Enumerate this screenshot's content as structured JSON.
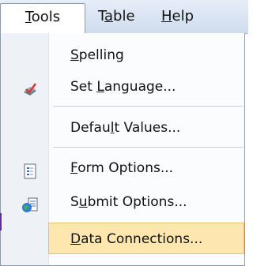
{
  "menubar": {
    "tools": {
      "pre": "",
      "ul": "T",
      "post": "ools"
    },
    "table": {
      "pre": "T",
      "ul": "a",
      "post": "ble"
    },
    "help": {
      "pre": "",
      "ul": "H",
      "post": "elp"
    }
  },
  "items": [
    {
      "pre": "",
      "ul": "S",
      "post": "pelling",
      "icon": "none"
    },
    {
      "pre": "Set ",
      "ul": "L",
      "post": "anguage...",
      "icon": "language-icon"
    },
    {
      "pre": "Defau",
      "ul": "l",
      "post": "t Values...",
      "icon": "none"
    },
    {
      "pre": "",
      "ul": "F",
      "post": "orm Options...",
      "icon": "form-options-icon"
    },
    {
      "pre": "S",
      "ul": "u",
      "post": "bmit Options...",
      "icon": "submit-options-icon"
    },
    {
      "pre": "",
      "ul": "D",
      "post": "ata Connections...",
      "icon": "none"
    }
  ],
  "colors": {
    "highlight": "#fde7ae",
    "menubar": "#d8e4f2"
  }
}
